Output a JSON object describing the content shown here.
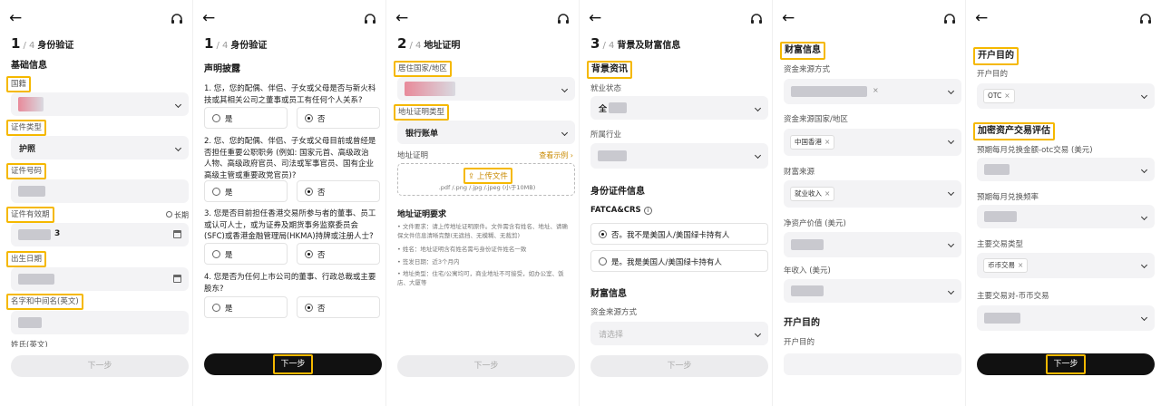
{
  "nav": {
    "back_icon": "back-arrow-icon",
    "support_icon": "headset-icon"
  },
  "colors": {
    "highlight": "#f5b800",
    "primary_button": "#111111",
    "disabled_button": "#ececee"
  },
  "step_total": "/ 4",
  "panel1": {
    "step_num": "1",
    "step_label": "身份验证",
    "section": "基础信息",
    "country_label": "国籍",
    "id_type_label": "证件类型",
    "id_type_value": "护照",
    "id_number_label": "证件号码",
    "expiry_label": "证件有效期",
    "long_term_label": "长期",
    "expiry_partial": "3",
    "dob_label": "出生日期",
    "name_label": "名字和中间名(英文)",
    "cut_label": "姓氏(英文)",
    "next_label": "下一步"
  },
  "panel2": {
    "step_num": "1",
    "step_label": "身份验证",
    "section": "声明披露",
    "questions": [
      "1. 您，您的配偶、伴侣、子女或父母是否与新火科技或其相关公司之董事或员工有任何个人关系?",
      "2. 您、您的配偶、伴侣、子女或父母目前或曾经是否担任重要公职职务 (例如: 国家元首、高级政治人物、高级政府官员、司法或军事官员、国有企业高级主管或重要政党官员)?",
      "3. 您是否目前担任香港交易所参与者的董事、员工或认可人士，或为证券及期货事务监察委员会(SFC)或香港金融管理局(HKMA)持牌或注册人士?",
      "4. 您是否为任何上市公司的董事、行政总裁或主要股东?"
    ],
    "yes_label": "是",
    "no_label": "否",
    "next_label": "下一步"
  },
  "panel3": {
    "step_num": "2",
    "step_label": "地址证明",
    "residence_label": "居住国家/地区",
    "proof_type_label": "地址证明类型",
    "proof_type_value": "银行账单",
    "proof_label": "地址证明",
    "example_link": "查看示例 ›",
    "upload_label": "上传文件",
    "upload_hint": ".pdf /.png /.jpg /.jpeg (小于10MB)",
    "req_title": "地址证明要求",
    "requirements": [
      "文件要求：请上传地址证明原件。文件需含有姓名、地址、请确保文件信息清晰完整(无遮挡、无模糊、无裁剪)",
      "姓名：地址证明含有姓名需与身份证件姓名一致",
      "签发日期：近3个月内",
      "地址类型：住宅/公寓均可，商业地址不可接受，如办公室、饭店、大厦等"
    ],
    "next_label": "下一步"
  },
  "panel4": {
    "step_num": "3",
    "step_label": "背景及财富信息",
    "section1": "背景资讯",
    "employment_label": "就业状态",
    "employment_partial": "全",
    "industry_label": "所属行业",
    "section2": "身份证件信息",
    "fatca_label": "FATCA&CRS",
    "fatca_no": "否。我不是美国人/美国绿卡持有人",
    "fatca_yes": "是。我是美国人/美国绿卡持有人",
    "section3": "财富信息",
    "funds_label": "资金来源方式",
    "funds_placeholder": "请选择",
    "next_label": "下一步"
  },
  "panel5": {
    "section": "财富信息",
    "funds_label": "资金来源方式",
    "funds_region_label": "资金来源国家/地区",
    "funds_region_tag": "中国香港",
    "wealth_source_label": "财富来源",
    "wealth_source_tag": "就业收入",
    "net_worth_label": "净资产价值 (美元)",
    "income_label": "年收入 (美元)",
    "section2": "开户目的",
    "purpose_label": "开户目的"
  },
  "panel6": {
    "section1": "开户目的",
    "purpose_label": "开户目的",
    "purpose_tag": "OTC",
    "section2": "加密资产交易评估",
    "monthly_amount_label": "预期每月兑换金额-otc交易 (美元)",
    "monthly_freq_label": "预期每月兑换频率",
    "trade_type_label": "主要交易类型",
    "trade_type_tag": "币币交易",
    "trade_pair_label": "主要交易对-币币交易",
    "next_label": "下一步"
  }
}
